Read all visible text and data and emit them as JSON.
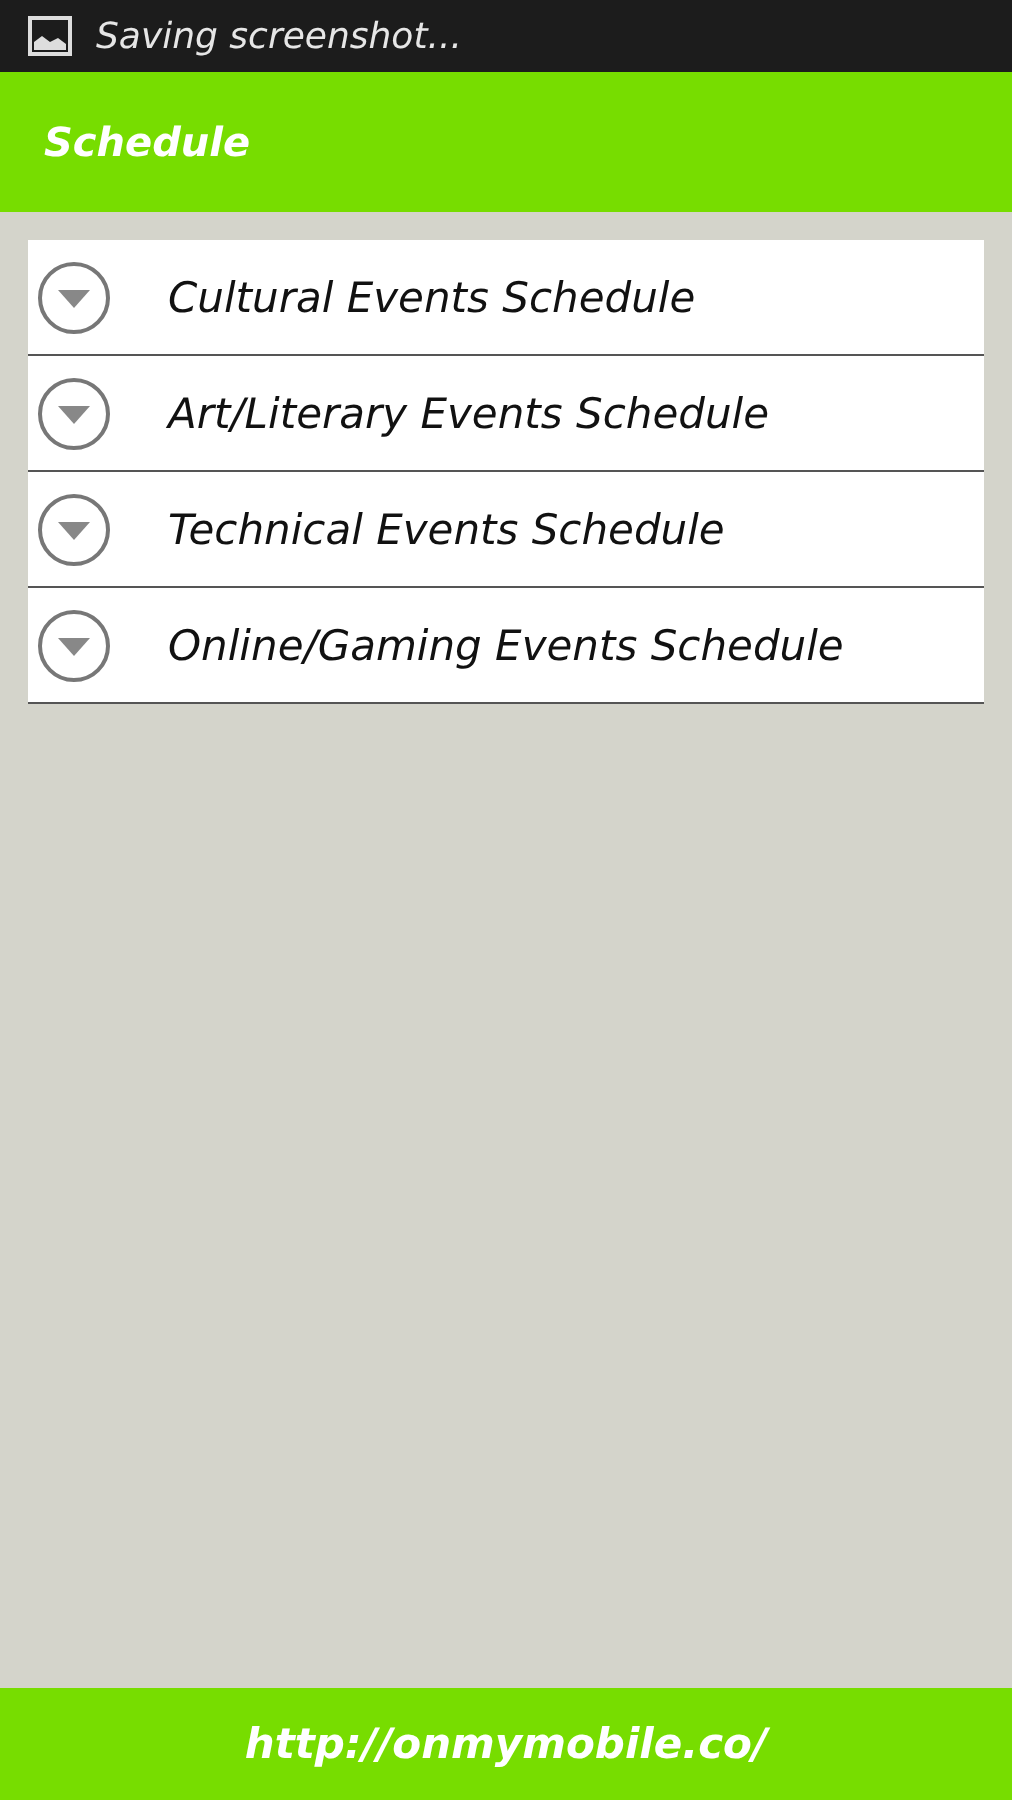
{
  "status_bar": {
    "notification": "Saving screenshot..."
  },
  "app_bar": {
    "title": "Schedule"
  },
  "sections": [
    {
      "title": "Cultural Events Schedule",
      "expanded": false
    },
    {
      "title": "Art/Literary Events Schedule",
      "expanded": false
    },
    {
      "title": "Technical Events Schedule",
      "expanded": false
    },
    {
      "title": "Online/Gaming Events Schedule",
      "expanded": false
    }
  ],
  "footer": {
    "link": "http://onmymobile.co/"
  }
}
